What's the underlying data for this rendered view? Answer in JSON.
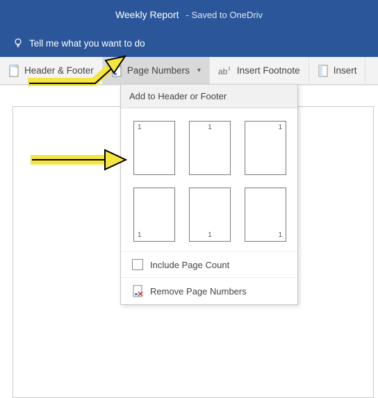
{
  "titleBar": {
    "docTitle": "Weekly Report",
    "savedText": "-   Saved to OneDriv"
  },
  "tellMe": {
    "text": "Tell me what you want to do"
  },
  "ribbon": {
    "headerFooter": "Header & Footer",
    "pageNumbers": "Page Numbers",
    "insertFootnote": "Insert Footnote",
    "insert": "Insert"
  },
  "dropdown": {
    "header": "Add to Header or Footer",
    "sampleNum": "1",
    "includePageCount": "Include Page Count",
    "removePageNumbers": "Remove Page Numbers"
  }
}
